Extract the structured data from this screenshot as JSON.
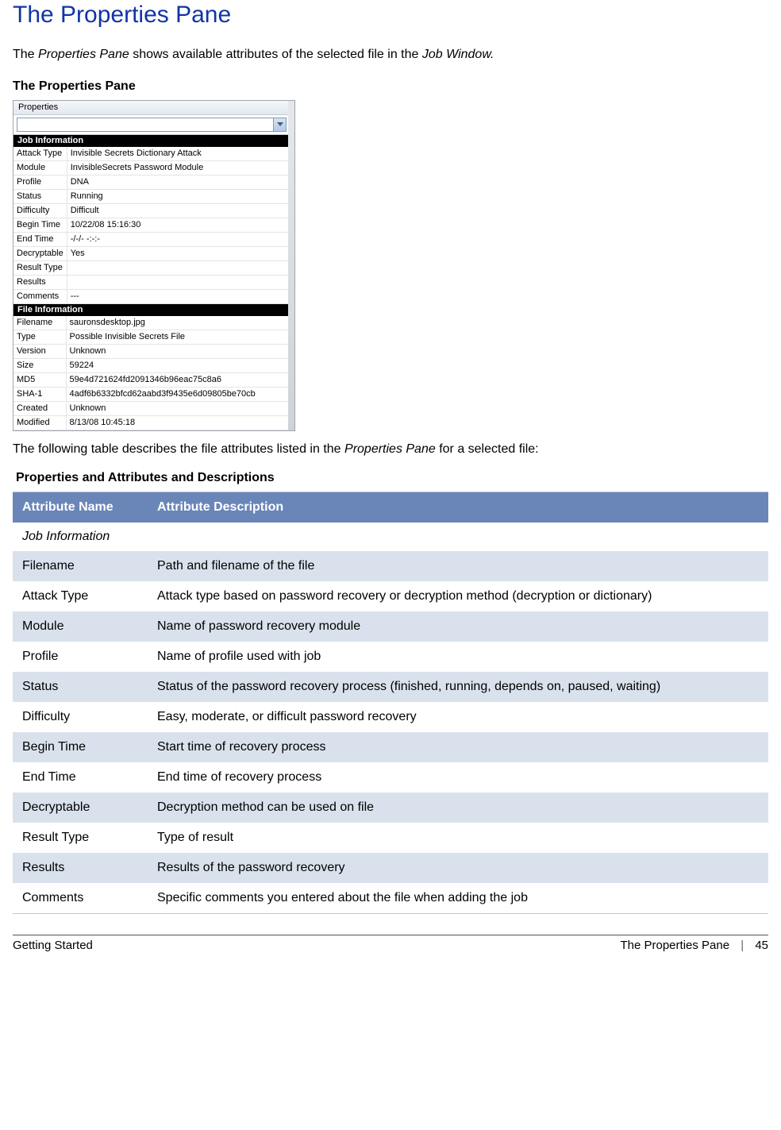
{
  "page": {
    "title": "The Properties Pane",
    "intro_pre": "The ",
    "intro_em1": "Properties Pane",
    "intro_mid": " shows available attributes of the selected file in the ",
    "intro_em2": "Job Window.",
    "caption": "The Properties Pane"
  },
  "pane": {
    "title": "Properties",
    "sections": [
      {
        "header": "Job Information",
        "rows": [
          {
            "k": "Attack Type",
            "v": "Invisible Secrets Dictionary Attack"
          },
          {
            "k": "Module",
            "v": "InvisibleSecrets Password Module"
          },
          {
            "k": "Profile",
            "v": "DNA"
          },
          {
            "k": "Status",
            "v": "Running"
          },
          {
            "k": "Difficulty",
            "v": "Difficult"
          },
          {
            "k": "Begin Time",
            "v": "10/22/08 15:16:30"
          },
          {
            "k": "End Time",
            "v": "-/-/- -:-:-"
          },
          {
            "k": "Decryptable",
            "v": "Yes"
          },
          {
            "k": "Result Type",
            "v": ""
          },
          {
            "k": "Results",
            "v": ""
          },
          {
            "k": "Comments",
            "v": "---"
          }
        ]
      },
      {
        "header": "File Information",
        "rows": [
          {
            "k": "Filename",
            "v": "sauronsdesktop.jpg"
          },
          {
            "k": "Type",
            "v": "Possible Invisible Secrets File"
          },
          {
            "k": "Version",
            "v": "Unknown"
          },
          {
            "k": "Size",
            "v": "59224"
          },
          {
            "k": "MD5",
            "v": "59e4d721624fd2091346b96eac75c8a6"
          },
          {
            "k": "SHA-1",
            "v": "4adf6b6332bfcd62aabd3f9435e6d09805be70cb"
          },
          {
            "k": "Created",
            "v": "Unknown"
          },
          {
            "k": "Modified",
            "v": "8/13/08 10:45:18"
          }
        ]
      }
    ]
  },
  "table_intro_pre": "The following table describes the file attributes listed in the ",
  "table_intro_em": "Properties Pane",
  "table_intro_post": " for a selected file:",
  "table_title": "Properties and Attributes and Descriptions",
  "table": {
    "th1": "Attribute Name",
    "th2": "Attribute Description",
    "section_label": "Job Information",
    "rows": [
      {
        "name": "Filename",
        "desc": "Path and filename of the file"
      },
      {
        "name": "Attack Type",
        "desc": "Attack type based on password recovery or decryption method (decryption or dictionary)"
      },
      {
        "name": "Module",
        "desc": "Name of password recovery module"
      },
      {
        "name": "Profile",
        "desc": "Name of profile used with job"
      },
      {
        "name": "Status",
        "desc": "Status of the password recovery process (finished, running, depends on, paused, waiting)"
      },
      {
        "name": "Difficulty",
        "desc": "Easy, moderate, or difficult password recovery"
      },
      {
        "name": "Begin Time",
        "desc": "Start time of recovery process"
      },
      {
        "name": "End Time",
        "desc": "End time of recovery process"
      },
      {
        "name": "Decryptable",
        "desc": "Decryption method can be used on file"
      },
      {
        "name": "Result Type",
        "desc": "Type of result"
      },
      {
        "name": "Results",
        "desc": "Results of the password recovery"
      },
      {
        "name": "Comments",
        "desc": "Specific comments you entered about the file when adding the job"
      }
    ]
  },
  "footer": {
    "left": "Getting Started",
    "right_section": "The Properties Pane",
    "separator": "|",
    "page_num": "45"
  }
}
